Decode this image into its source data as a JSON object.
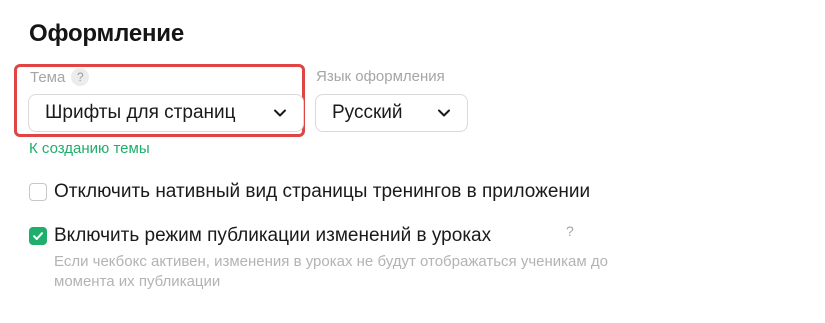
{
  "section": {
    "title": "Оформление"
  },
  "theme": {
    "label": "Тема",
    "help": "?",
    "selected": "Шрифты для страниц",
    "create_link": "К созданию темы"
  },
  "language": {
    "label": "Язык оформления",
    "selected": "Русский"
  },
  "options": [
    {
      "label": "Отключить нативный вид страницы тренингов в приложении",
      "checked": false
    },
    {
      "label": "Включить режим публикации изменений в уроках",
      "checked": true,
      "help": "?",
      "hint": "Если чекбокс активен, изменения в уроках не будут отображаться ученикам до момента их публикации"
    }
  ],
  "colors": {
    "accent": "#1fae6b",
    "highlight": "#e04444"
  },
  "icons": {
    "select_arrow": "chevron-down-icon",
    "checkmark": "check-icon"
  }
}
